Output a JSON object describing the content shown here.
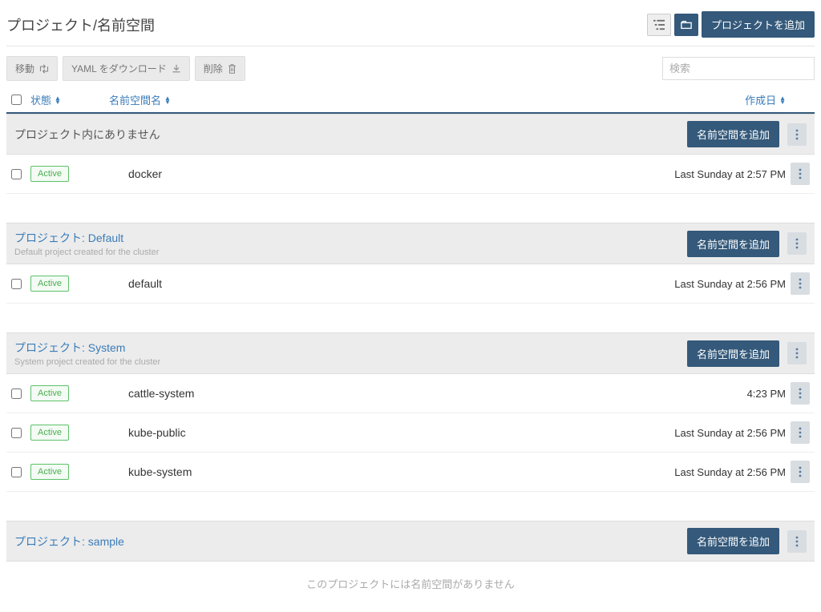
{
  "header": {
    "title": "プロジェクト/名前空間",
    "add_project_label": "プロジェクトを追加"
  },
  "toolbar": {
    "move_label": "移動",
    "yaml_download_label": "YAML をダウンロード",
    "delete_label": "削除",
    "search_placeholder": "検索"
  },
  "columns": {
    "status": "状態",
    "name": "名前空間名",
    "created": "作成日"
  },
  "groups": [
    {
      "title": "プロジェクト内にありません",
      "is_link": false,
      "subtitle": "",
      "add_ns_label": "名前空間を追加",
      "rows": [
        {
          "status": "Active",
          "name": "docker",
          "date": "Last Sunday at 2:57 PM"
        }
      ]
    },
    {
      "title": "プロジェクト: Default",
      "is_link": true,
      "subtitle": "Default project created for the cluster",
      "add_ns_label": "名前空間を追加",
      "rows": [
        {
          "status": "Active",
          "name": "default",
          "date": "Last Sunday at 2:56 PM"
        }
      ]
    },
    {
      "title": "プロジェクト: System",
      "is_link": true,
      "subtitle": "System project created for the cluster",
      "add_ns_label": "名前空間を追加",
      "rows": [
        {
          "status": "Active",
          "name": "cattle-system",
          "date": "4:23 PM"
        },
        {
          "status": "Active",
          "name": "kube-public",
          "date": "Last Sunday at 2:56 PM"
        },
        {
          "status": "Active",
          "name": "kube-system",
          "date": "Last Sunday at 2:56 PM"
        }
      ]
    },
    {
      "title": "プロジェクト: sample",
      "is_link": true,
      "subtitle": "",
      "add_ns_label": "名前空間を追加",
      "rows": [],
      "empty_message": "このプロジェクトには名前空間がありません"
    }
  ]
}
